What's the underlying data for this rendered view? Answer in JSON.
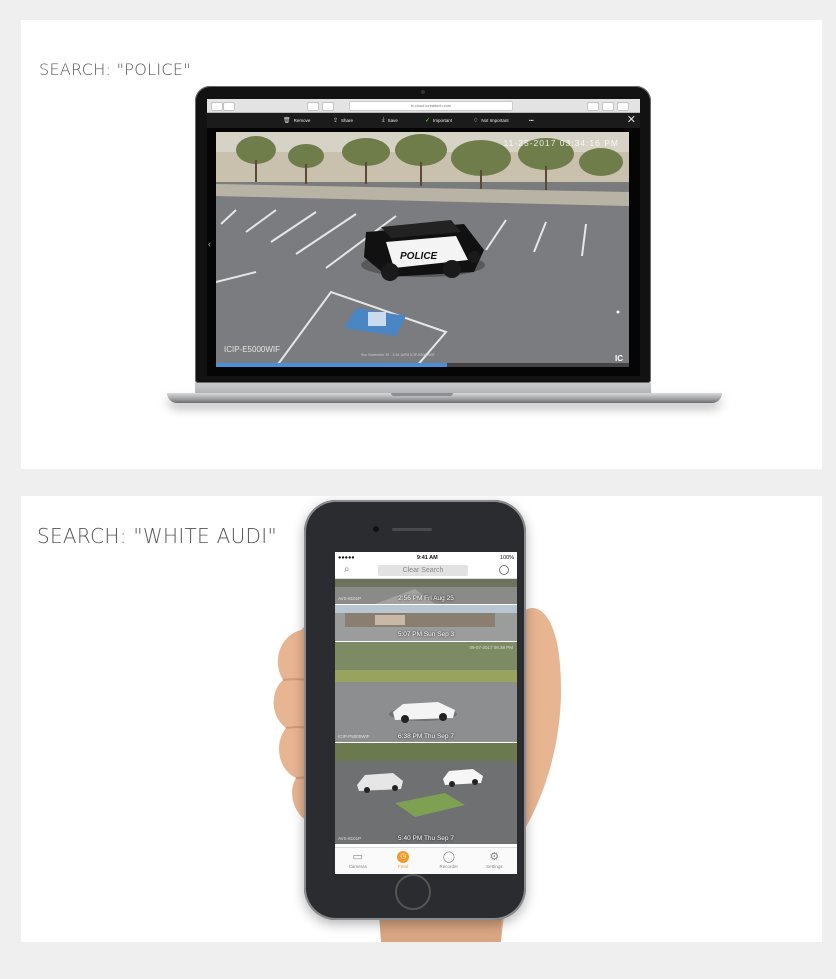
{
  "panels": [
    {
      "heading": "SEARCH: \"POLICE\"",
      "laptop": {
        "browser_url": "ic.cloud.icrealtech.com",
        "toolbar_actions": [
          {
            "label": "Remove",
            "icon": "trash-icon"
          },
          {
            "label": "Share",
            "icon": "share-icon"
          },
          {
            "label": "Save",
            "icon": "download-icon"
          },
          {
            "label": "Important",
            "icon": "thumbs-up-icon"
          },
          {
            "label": "Not Important",
            "icon": "thumbs-down-icon"
          },
          {
            "label": "•••",
            "icon": "more-icon"
          }
        ],
        "video": {
          "timestamp": "11-25-2017 03:34:16 PM",
          "camera_label": "ICIP-E5000WIF",
          "sub_label": "Sun November 26 - 3:34:16PM ICIP-E5000WIF",
          "vehicle_text": "POLICE",
          "brand": "IC",
          "progress_fraction": 0.56
        }
      }
    },
    {
      "heading": "SEARCH: \"WHITE AUDI\"",
      "phone": {
        "status_time": "9:41 AM",
        "signal_text": "●●●●● ",
        "battery_text": "100%",
        "search_button": "Clear Search",
        "clips": [
          {
            "caption": "2:56 PM Fri Aug 25",
            "camera": "AVS-8101P"
          },
          {
            "caption": "5:07 PM Sun Sep 3",
            "camera": ""
          },
          {
            "caption": "6:38 PM Thu Sep 7",
            "camera": "ICIP-P5000WIF",
            "timestamp": "09-07-2017 06:38 PM"
          },
          {
            "caption": "5:40 PM Thu Sep 7",
            "camera": "AVS-8101P"
          }
        ],
        "tabs": [
          {
            "label": "Cameras",
            "icon": "camera-icon",
            "active": false
          },
          {
            "label": "Feed",
            "icon": "clock-icon",
            "active": true
          },
          {
            "label": "Recorder",
            "icon": "record-icon",
            "active": false
          },
          {
            "label": "Settings",
            "icon": "gear-icon",
            "active": false
          }
        ]
      }
    }
  ],
  "colors": {
    "page_background": "#efefef",
    "panel_background": "#ffffff",
    "progress_blue": "#4b8fd9",
    "feed_tab_orange": "#f39a2b"
  }
}
